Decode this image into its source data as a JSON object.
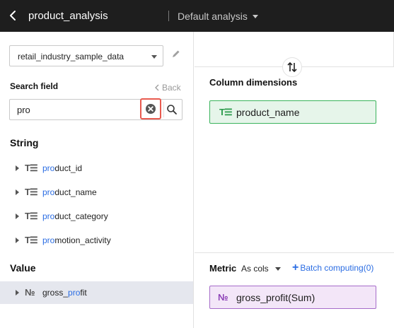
{
  "header": {
    "title": "product_analysis",
    "analysis_selector": "Default analysis"
  },
  "left_panel": {
    "dataset": "retail_industry_sample_data",
    "search_label": "Search field",
    "back_label": "Back",
    "search_value": "pro",
    "string_section": "String",
    "value_section": "Value",
    "string_fields": [
      {
        "icon": "T☰",
        "match": "pro",
        "rest": "duct_id"
      },
      {
        "icon": "T☰",
        "match": "pro",
        "rest": "duct_name"
      },
      {
        "icon": "T☰",
        "match": "pro",
        "rest": "duct_category"
      },
      {
        "icon": "T☰",
        "match": "pro",
        "rest": "motion_activity"
      }
    ],
    "value_fields": [
      {
        "icon": "№",
        "prefix": "gross_",
        "match": "pro",
        "rest": "fit"
      }
    ]
  },
  "right_panel": {
    "column_dimensions_label": "Column dimensions",
    "dimension_chip": {
      "icon": "T☰",
      "label": "product_name"
    },
    "metric_label": "Metric",
    "metric_mode": "As cols",
    "batch_label": "Batch computing(0)",
    "metric_chip": {
      "icon": "№",
      "label": "gross_profit(Sum)"
    }
  },
  "colors": {
    "header_bg": "#1e1e1e",
    "highlight": "#2b6de3",
    "dimension_green": "#3bb45c",
    "metric_purple": "#a66cc9",
    "clear_outline": "#e85a4f"
  }
}
